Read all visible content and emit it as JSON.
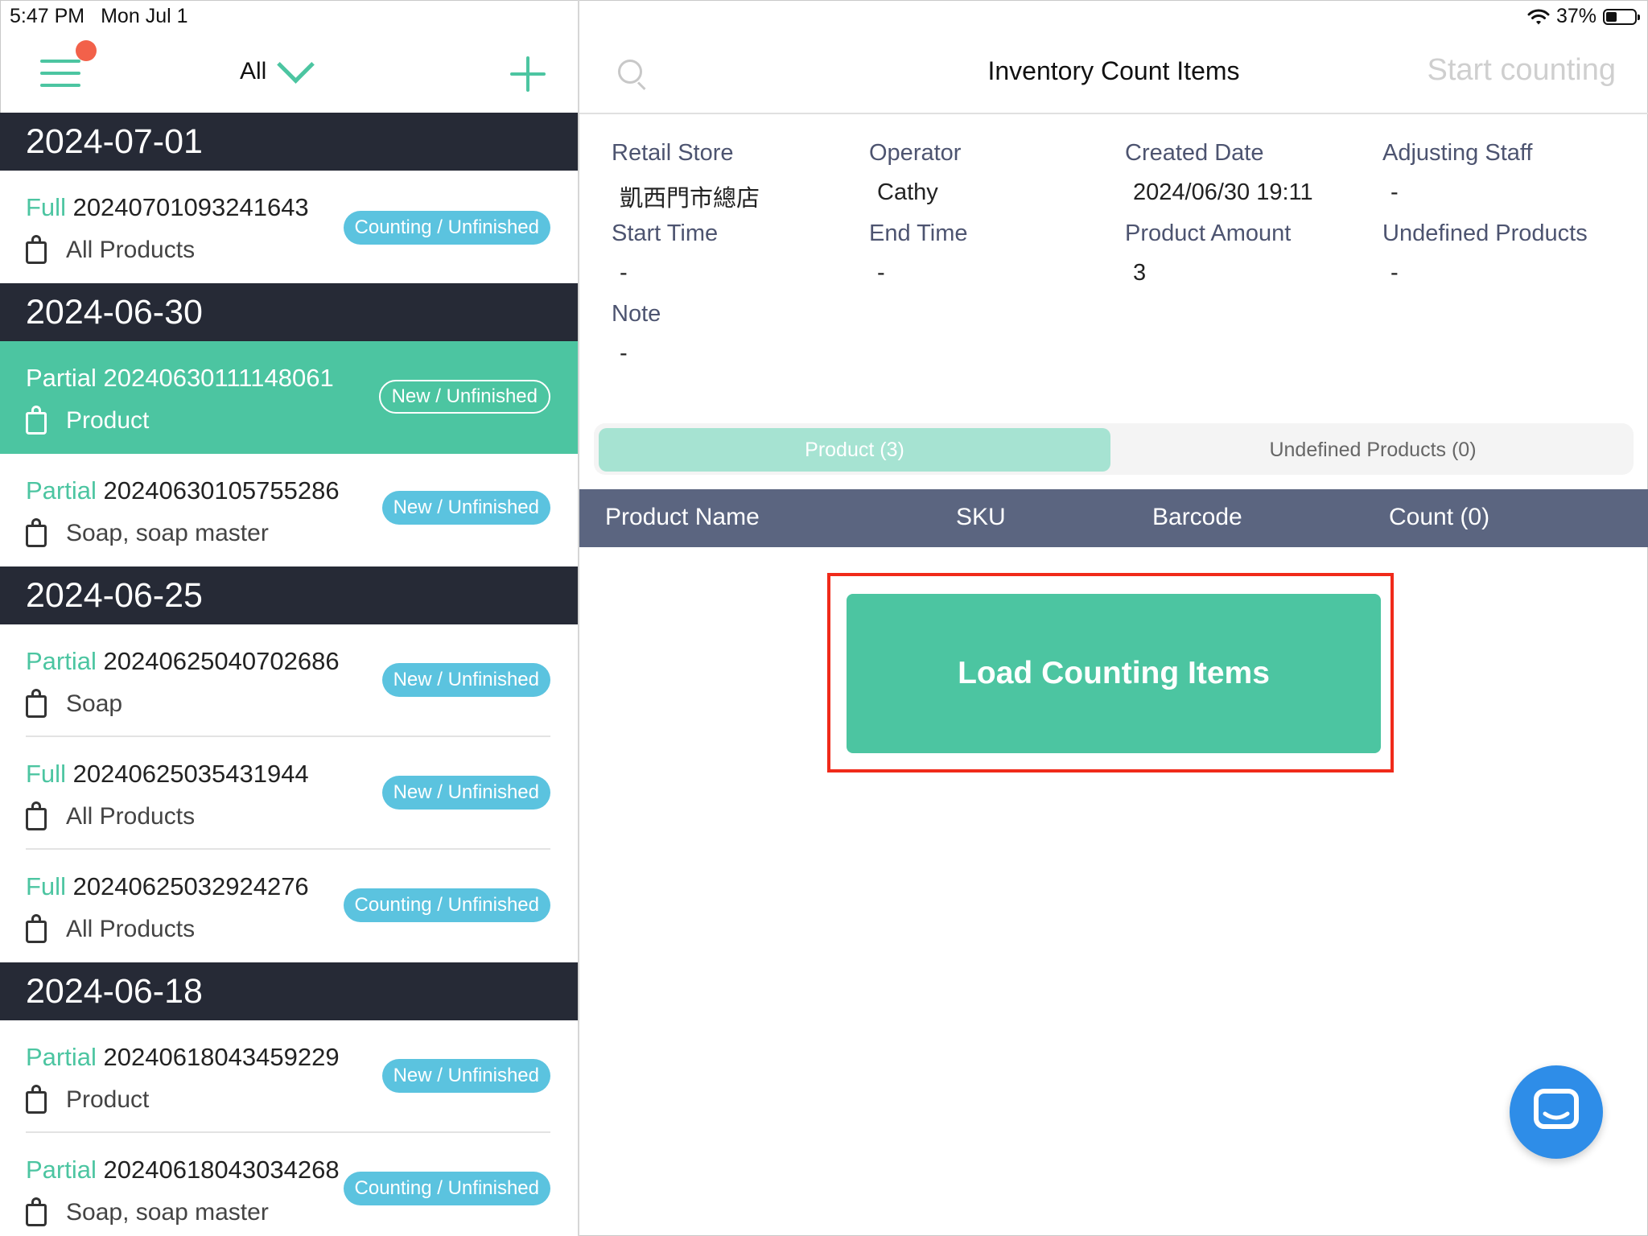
{
  "status_bar": {
    "time": "5:47 PM",
    "date": "Mon Jul 1",
    "battery": "37%",
    "battery_level": 0.37
  },
  "sidebar": {
    "filter_label": "All",
    "groups": [
      {
        "date": "2024-07-01",
        "items": [
          {
            "type": "Full",
            "id": "20240701093241643",
            "scope": "All Products",
            "status": "Counting / Unfinished",
            "selected": false
          }
        ]
      },
      {
        "date": "2024-06-30",
        "items": [
          {
            "type": "Partial",
            "id": "20240630111148061",
            "scope": "Product",
            "status": "New / Unfinished",
            "selected": true
          },
          {
            "type": "Partial",
            "id": "20240630105755286",
            "scope": "Soap, soap master",
            "status": "New / Unfinished",
            "selected": false
          }
        ]
      },
      {
        "date": "2024-06-25",
        "items": [
          {
            "type": "Partial",
            "id": "20240625040702686",
            "scope": "Soap",
            "status": "New / Unfinished",
            "selected": false
          },
          {
            "type": "Full",
            "id": "20240625035431944",
            "scope": "All Products",
            "status": "New / Unfinished",
            "selected": false
          },
          {
            "type": "Full",
            "id": "20240625032924276",
            "scope": "All Products",
            "status": "Counting / Unfinished",
            "selected": false
          }
        ]
      },
      {
        "date": "2024-06-18",
        "items": [
          {
            "type": "Partial",
            "id": "20240618043459229",
            "scope": "Product",
            "status": "New / Unfinished",
            "selected": false
          },
          {
            "type": "Partial",
            "id": "20240618043034268",
            "scope": "Soap, soap master",
            "status": "Counting / Unfinished",
            "selected": false
          }
        ]
      }
    ]
  },
  "header": {
    "title": "Inventory Count Items",
    "start_button": "Start counting"
  },
  "info": {
    "retail_store": {
      "label": "Retail Store",
      "value": "凱西門市總店"
    },
    "operator": {
      "label": "Operator",
      "value": "Cathy"
    },
    "created_date": {
      "label": "Created Date",
      "value": "2024/06/30 19:11"
    },
    "adjusting_staff": {
      "label": "Adjusting Staff",
      "value": "-"
    },
    "start_time": {
      "label": "Start Time",
      "value": "-"
    },
    "end_time": {
      "label": "End Time",
      "value": "-"
    },
    "product_amount": {
      "label": "Product Amount",
      "value": "3"
    },
    "undefined_products": {
      "label": "Undefined Products",
      "value": "-"
    },
    "note": {
      "label": "Note",
      "value": "-"
    }
  },
  "tabs": {
    "product": "Product (3)",
    "undefined": "Undefined Products (0)"
  },
  "table": {
    "columns": [
      "Product Name",
      "SKU",
      "Barcode",
      "Count (0)"
    ]
  },
  "load_button": "Load Counting Items",
  "colors": {
    "accent": "#4cc5a1",
    "badge": "#5bc3df",
    "dark_header": "#262a36",
    "table_header": "#5b6580",
    "highlight": "#f02a1a",
    "chat": "#2e8de8"
  }
}
